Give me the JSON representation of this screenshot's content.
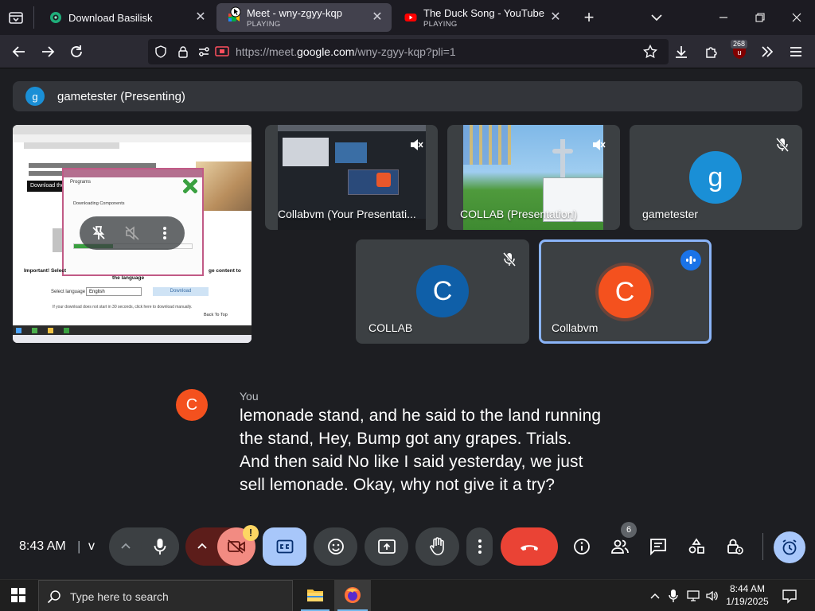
{
  "browser": {
    "tabs": [
      {
        "title": "Download Basilisk",
        "subtitle": "",
        "icon": "basilisk-icon"
      },
      {
        "title": "Meet - wny-zgyy-kqp",
        "subtitle": "PLAYING",
        "icon": "meet-icon"
      },
      {
        "title": "The Duck Song - YouTube",
        "subtitle": "PLAYING",
        "icon": "youtube-icon"
      }
    ],
    "url_prefix": "https://meet.",
    "url_host": "google.com",
    "url_rest": "/wny-zgyy-kqp?pli=1",
    "extension_badge": "268"
  },
  "meet": {
    "presenting_avatar": "g",
    "presenting_label": "gametester (Presenting)",
    "tiles": [
      {
        "name": "Collabvm (Your Presentati...",
        "muted": true
      },
      {
        "name": "COLLAB (Presentation)",
        "muted": true
      },
      {
        "name": "gametester",
        "avatar": "g",
        "muted": true,
        "color": "#1a8fd6"
      },
      {
        "name": "COLLAB",
        "avatar": "C",
        "muted": true,
        "color": "#0f5fa8"
      },
      {
        "name": "Collabvm",
        "avatar": "C",
        "muted": false,
        "speaking": true,
        "color": "#f4511e"
      }
    ],
    "caption": {
      "avatar": "C",
      "speaker": "You",
      "lines": [
        "lemonade stand, and he said to the land running",
        "the stand, Hey, Bump got any grapes. Trials.",
        "And then said No like I said yesterday, we just",
        "sell lemonade. Okay, why not give it a try?"
      ]
    },
    "controls": {
      "time": "8:43 AM",
      "separator": "|",
      "meeting_code": "v",
      "people_count": "6",
      "camera_warning": "!"
    },
    "thumb": {
      "download_btn": "Download the",
      "important": "Important! Select",
      "important_tail": "ge content to",
      "language_heading": "the language",
      "select_label": "Select language",
      "select_value": "English",
      "download_button2": "Download",
      "footer_text": "If your download does not start in 30 seconds, click here to download manually.",
      "back_to_top": "Back To Top",
      "dialog_title": "Programs",
      "dialog_sub": "Downloading Components"
    }
  },
  "taskbar": {
    "search_placeholder": "Type here to search",
    "time": "8:44 AM",
    "date": "1/19/2025"
  },
  "colors": {
    "accent_blue": "#8ab4f8",
    "end_call_red": "#ea4335",
    "camera_off_bg": "#f28b82",
    "caption_avatar": "#f4511e"
  }
}
